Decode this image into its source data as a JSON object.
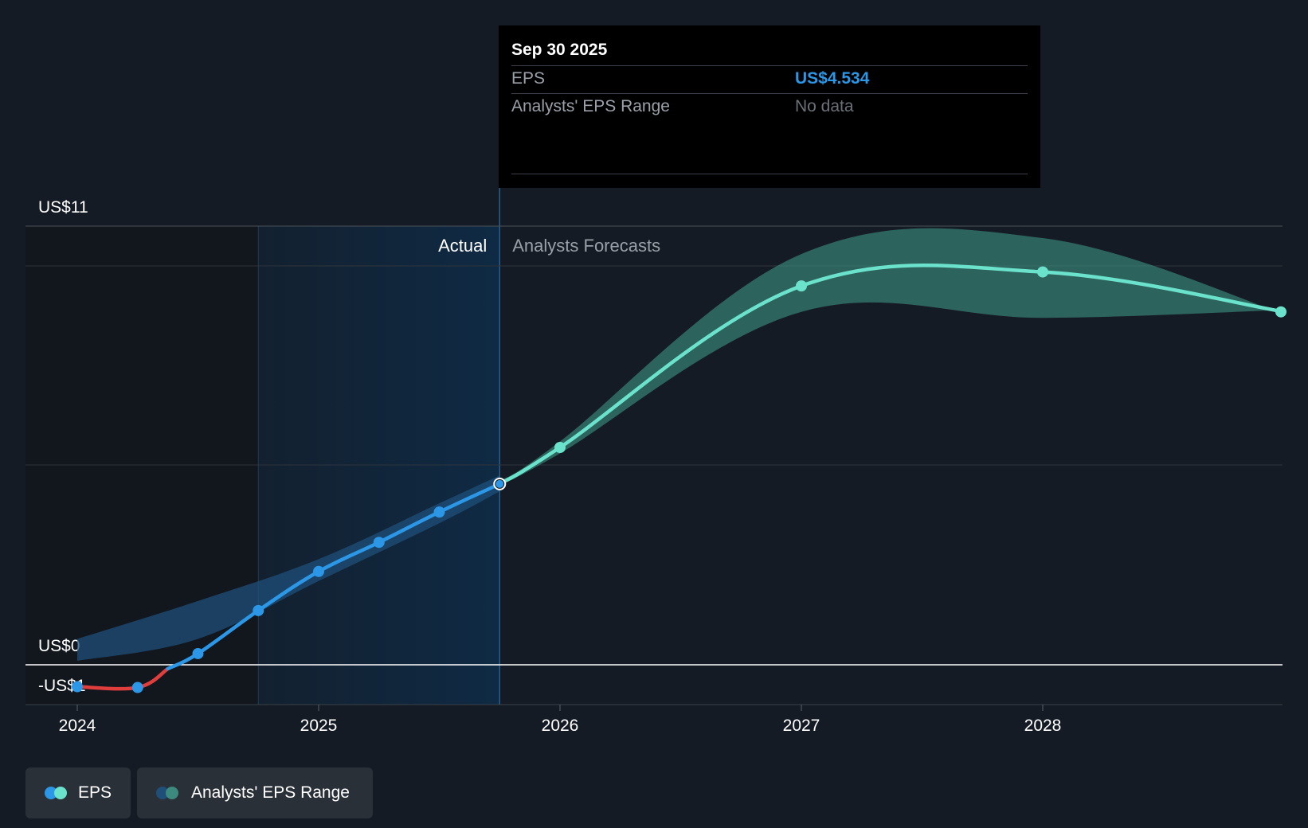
{
  "chart_data": {
    "type": "line",
    "y_ticks": [
      {
        "label": "US$11",
        "value": 11
      },
      {
        "label": "US$0",
        "value": 0
      },
      {
        "label": "-US$1",
        "value": -1
      }
    ],
    "x_ticks": [
      {
        "label": "2024",
        "value": 2024.0
      },
      {
        "label": "2025",
        "value": 2025.0
      },
      {
        "label": "2026",
        "value": 2026.0
      },
      {
        "label": "2027",
        "value": 2027.0
      },
      {
        "label": "2028",
        "value": 2028.0
      }
    ],
    "xlim": [
      2023.78,
      2029.0
    ],
    "ylim": [
      -1,
      11
    ],
    "actual_region": {
      "start": 2024.75,
      "end": 2025.75
    },
    "region_labels": {
      "actual": "Actual",
      "forecast": "Analysts Forecasts"
    },
    "series": [
      {
        "name": "EPS",
        "points": [
          [
            2024.0,
            -0.55
          ],
          [
            2024.25,
            -0.57
          ],
          [
            2024.5,
            0.28
          ],
          [
            2024.75,
            1.36
          ],
          [
            2025.0,
            2.34
          ],
          [
            2025.25,
            3.07
          ],
          [
            2025.5,
            3.83
          ],
          [
            2025.75,
            4.534
          ]
        ]
      },
      {
        "name": "EPS",
        "points": [
          [
            2025.75,
            4.534
          ],
          [
            2026.0,
            5.45
          ],
          [
            2027.0,
            9.5
          ],
          [
            2028.0,
            9.85
          ],
          [
            2029.0,
            8.85
          ]
        ]
      }
    ],
    "actual_range": {
      "x": [
        2024.0,
        2024.5,
        2025.0,
        2025.5,
        2025.75
      ],
      "low": [
        0.1,
        0.65,
        2.1,
        3.55,
        4.35
      ],
      "high": [
        0.65,
        1.6,
        2.65,
        4.05,
        4.75
      ]
    },
    "forecast_range": {
      "x": [
        2025.75,
        2026.0,
        2027.0,
        2028.0,
        2029.0
      ],
      "low": [
        4.5,
        5.3,
        8.85,
        8.7,
        8.9
      ],
      "high": [
        4.6,
        5.6,
        10.3,
        10.7,
        8.8
      ]
    },
    "colors": {
      "eps_actual": "#2b97e6",
      "eps_negative": "#e03d3d",
      "eps_forecast": "#6be3cc",
      "range_actual": "#1f4f79",
      "range_forecast": "#3b8a7d",
      "highlight": "#0f2a44"
    }
  },
  "tooltip": {
    "date": "Sep 30 2025",
    "eps_label": "EPS",
    "eps_value": "US$4.534",
    "range_label": "Analysts' EPS Range",
    "range_value": "No data"
  },
  "legend": {
    "eps": "EPS",
    "range": "Analysts' EPS Range"
  }
}
